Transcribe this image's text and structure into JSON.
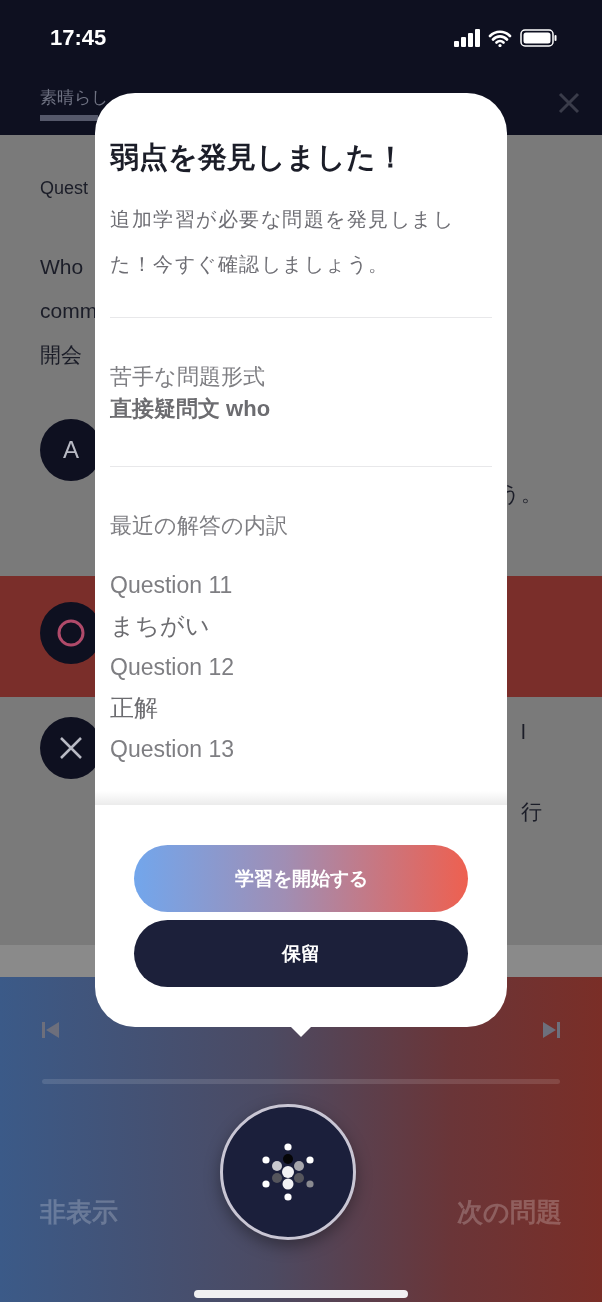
{
  "status_bar": {
    "time": "17:45"
  },
  "header": {
    "progress_text": "素晴らし",
    "level": 0.12
  },
  "question": {
    "label": "Quest",
    "lines": [
      "Who",
      "comm",
      "開会"
    ]
  },
  "options": [
    {
      "kind": "letter",
      "letter": "A",
      "fragments": [
        "う。"
      ],
      "selected": false
    },
    {
      "kind": "circle",
      "selected": true
    },
    {
      "kind": "cross",
      "fragments": [
        "l",
        "行"
      ],
      "selected": false
    }
  ],
  "popup": {
    "title": "弱点を発見しました！",
    "description": "追加学習が必要な問題を発見しました！今すぐ確認しましょう。",
    "weak_label": "苦手な問題形式",
    "weak_value": "直接疑問文 who",
    "breakdown_label": "最近の解答の内訳",
    "answers": [
      {
        "question": "Question 11",
        "result": "まちがい"
      },
      {
        "question": "Question 12",
        "result": "正解"
      },
      {
        "question": "Question 13"
      }
    ],
    "buttons": [
      {
        "kind": "primary",
        "label": "学習を開始する"
      },
      {
        "kind": "secondary",
        "label": "保留"
      }
    ]
  },
  "player": {
    "hide_label": "非表示",
    "next_label": "次の問題"
  }
}
